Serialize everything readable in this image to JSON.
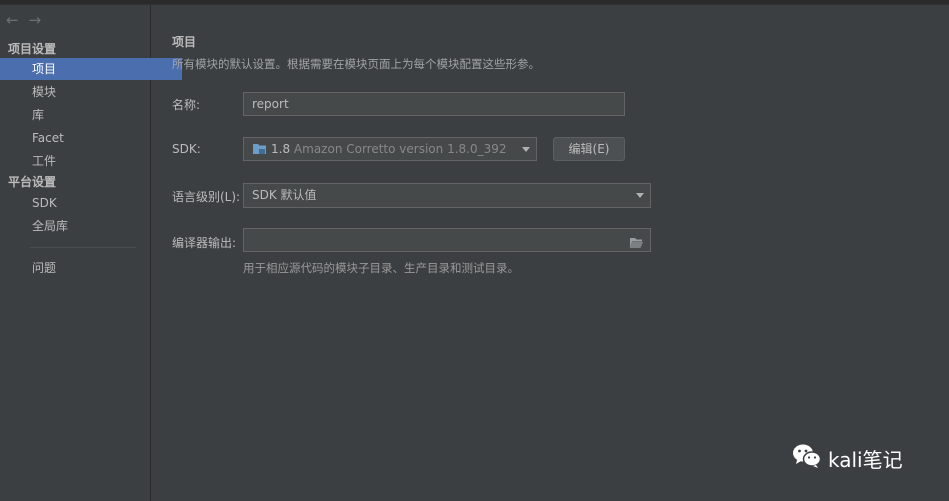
{
  "nav": {
    "back_glyph": "←",
    "forward_glyph": "→"
  },
  "sidebar": {
    "project_settings_header": "项目设置",
    "project_items": [
      {
        "label": "项目",
        "selected": true
      },
      {
        "label": "模块",
        "selected": false
      },
      {
        "label": "库",
        "selected": false
      },
      {
        "label": "Facet",
        "selected": false
      },
      {
        "label": "工件",
        "selected": false
      }
    ],
    "platform_settings_header": "平台设置",
    "platform_items": [
      {
        "label": "SDK"
      },
      {
        "label": "全局库"
      }
    ],
    "problems_label": "问题"
  },
  "main": {
    "title": "项目",
    "description": "所有模块的默认设置。根据需要在模块页面上为每个模块配置这些形参。",
    "name_label": "名称:",
    "name_value": "report",
    "sdk_label": "SDK:",
    "sdk_version_short": "1.8",
    "sdk_version_full": "Amazon Corretto version 1.8.0_392",
    "edit_button_label": "编辑(E)",
    "language_level_label": "语言级别(L):",
    "language_level_value": "SDK 默认值",
    "compiler_output_label": "编译器输出:",
    "compiler_output_value": "",
    "compiler_output_hint": "用于相应源代码的模块子目录、生产目录和测试目录。"
  },
  "watermark": {
    "text": "kali笔记"
  },
  "colors": {
    "background": "#3c3f41",
    "selection": "#4b6eaf",
    "field_background": "#45494a",
    "field_border": "#646464",
    "text": "#bbbbbb"
  }
}
